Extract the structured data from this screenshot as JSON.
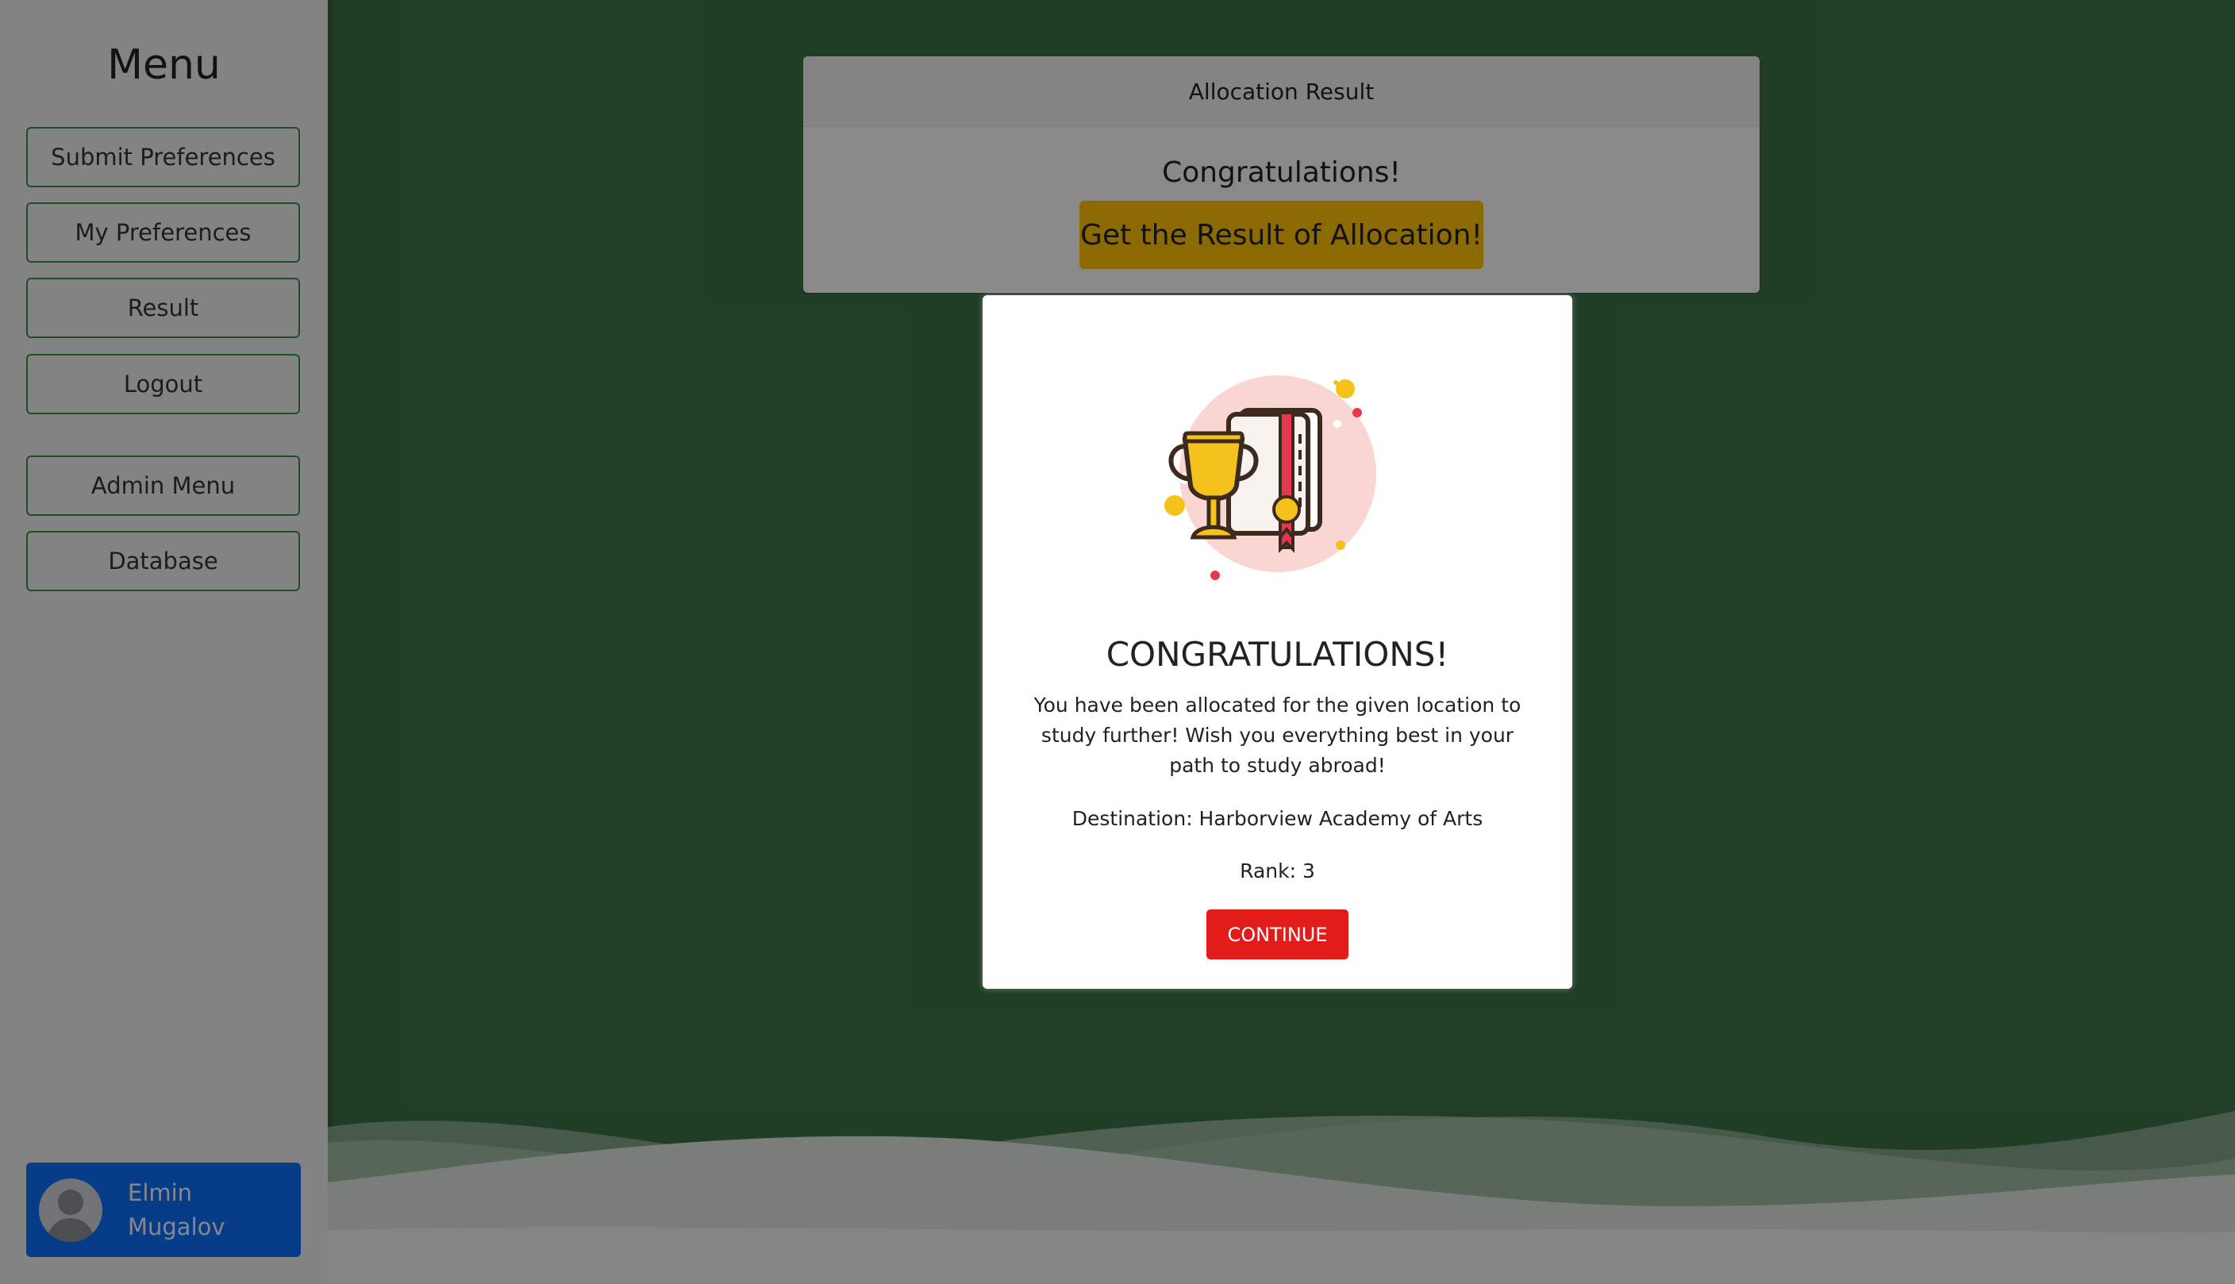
{
  "sidebar": {
    "title": "Menu",
    "items": [
      {
        "label": "Submit Preferences"
      },
      {
        "label": "My Preferences"
      },
      {
        "label": "Result"
      },
      {
        "label": "Logout"
      },
      {
        "label": "Admin Menu"
      },
      {
        "label": "Database"
      }
    ],
    "user": {
      "first_name": "Elmin",
      "last_name": "Mugalov"
    }
  },
  "result_card": {
    "header": "Allocation Result",
    "subtitle": "Congratulations!",
    "button_label": "Get the Result of Allocation!"
  },
  "modal": {
    "title": "CONGRATULATIONS!",
    "message": "You have been allocated for the given location to study further! Wish you everything best in your path to study abroad!",
    "destination": "Destination: Harborview Academy of Arts",
    "rank": "Rank: 3",
    "continue_label": "CONTINUE",
    "icon": "trophy-certificate-icon"
  },
  "colors": {
    "page_bg": "#3b7245",
    "sidebar_bg": "#efefef",
    "result_button": "#ffc107",
    "continue_button": "#e21b1b",
    "user_card": "#0c6ef8"
  }
}
